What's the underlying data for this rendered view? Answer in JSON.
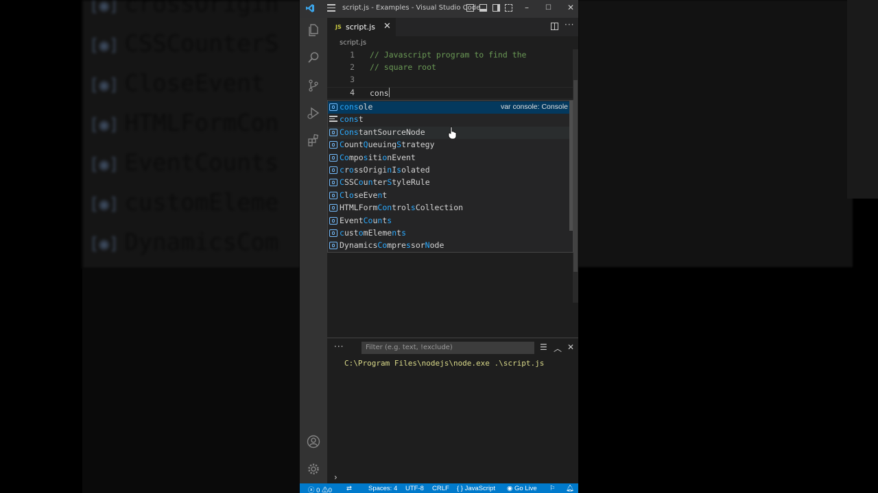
{
  "background_reflection": {
    "items": [
      "crossOrigin",
      "CSSCounterS",
      "CloseEvent",
      "HTMLFormCon",
      "EventCounts",
      "customEleme",
      "DynamicsCom"
    ]
  },
  "window": {
    "title": "script.js - Examples - Visual Studio Code",
    "controls": {
      "minimize": "–",
      "maximize": "☐",
      "close": "✕"
    }
  },
  "activity_bar": {
    "items": [
      "explorer-icon",
      "search-icon",
      "source-control-icon",
      "run-debug-icon",
      "extensions-icon"
    ],
    "bottom": [
      "accounts-icon",
      "manage-gear-icon"
    ]
  },
  "tab": {
    "lang_badge": "JS",
    "label": "script.js",
    "close": "✕"
  },
  "breadcrumb": {
    "file": "script.js"
  },
  "editor": {
    "lines": [
      {
        "num": "1",
        "text": "// Javascript program to find the",
        "comment": true
      },
      {
        "num": "2",
        "text": "// square root",
        "comment": true
      },
      {
        "num": "3",
        "text": "",
        "comment": false
      },
      {
        "num": "4",
        "text": "cons",
        "comment": false
      }
    ]
  },
  "suggestions": {
    "items": [
      {
        "kind": "variable",
        "label": "console",
        "match": "cons",
        "detail": "var console: Console",
        "selected": true
      },
      {
        "kind": "keyword",
        "label": "const",
        "match": "cons",
        "selected": false
      },
      {
        "kind": "variable",
        "label": "ConstantSourceNode",
        "match": "Cons",
        "selected": false
      },
      {
        "kind": "variable",
        "label": "CountQueuingStrategy",
        "selected": false
      },
      {
        "kind": "variable",
        "label": "CompositionEvent",
        "selected": false
      },
      {
        "kind": "variable",
        "label": "crossOriginIsolated",
        "selected": false
      },
      {
        "kind": "variable",
        "label": "CSSCounterStyleRule",
        "selected": false
      },
      {
        "kind": "variable",
        "label": "CloseEvent",
        "selected": false
      },
      {
        "kind": "variable",
        "label": "HTMLFormControlsCollection",
        "selected": false
      },
      {
        "kind": "variable",
        "label": "EventCounts",
        "selected": false
      },
      {
        "kind": "variable",
        "label": "customElements",
        "selected": false
      },
      {
        "kind": "variable",
        "label": "DynamicsCompressorNode",
        "selected": false
      }
    ]
  },
  "panel": {
    "filter_placeholder": "Filter (e.g. text, !exclude)",
    "output_line": "C:\\Program Files\\nodejs\\node.exe .\\script.js",
    "prompt": "›"
  },
  "status_bar": {
    "errors": "0",
    "warnings": "0",
    "indent": "Spaces: 4",
    "encoding": "UTF-8",
    "eol": "CRLF",
    "language": "JavaScript",
    "live": "Go Live"
  },
  "colors": {
    "accent": "#007acc",
    "comment": "#6a9955",
    "match_highlight": "#2aaaff",
    "selected_row": "#04395e"
  }
}
